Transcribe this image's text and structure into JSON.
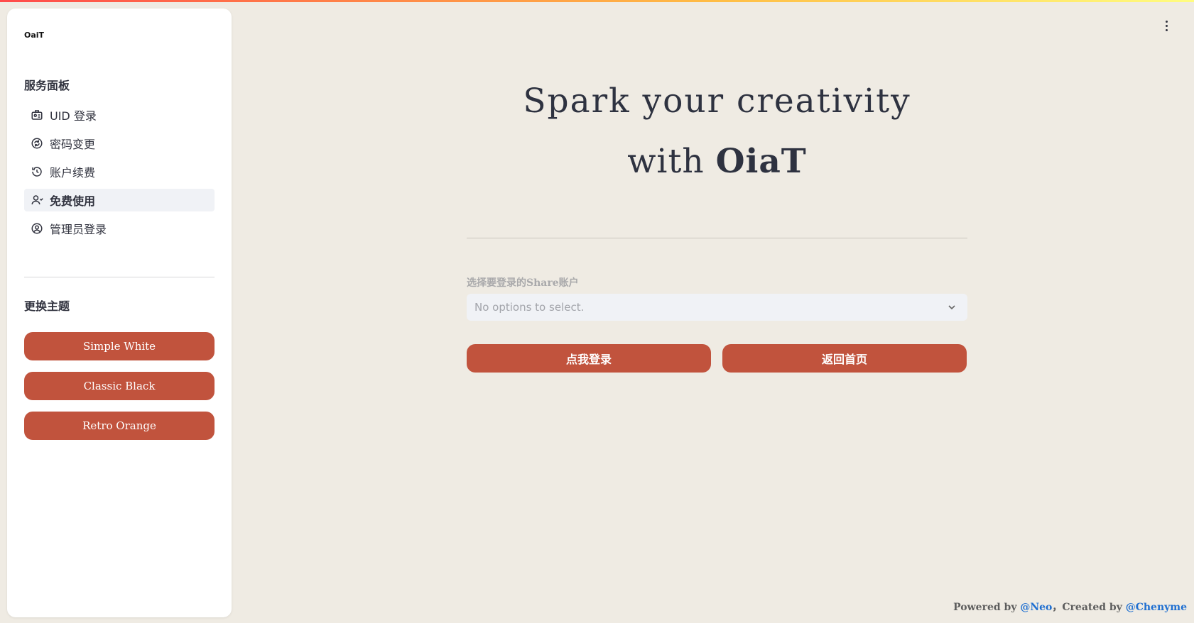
{
  "app": {
    "logo_text": "OaiT",
    "accent_color": "#c1533d"
  },
  "sidebar": {
    "panel_title": "服务面板",
    "items": [
      {
        "label": "UID 登录",
        "icon": "id-card-icon",
        "active": false
      },
      {
        "label": "密码变更",
        "icon": "refresh-circle-icon",
        "active": false
      },
      {
        "label": "账户续费",
        "icon": "history-icon",
        "active": false
      },
      {
        "label": "免费使用",
        "icon": "user-icon",
        "active": true
      },
      {
        "label": "管理员登录",
        "icon": "account-circle-icon",
        "active": false
      }
    ],
    "theme_title": "更换主题",
    "themes": [
      "Simple White",
      "Classic Black",
      "Retro Orange"
    ]
  },
  "main": {
    "hero_line1": "Spark your creativity",
    "hero_line2_prefix": "with ",
    "hero_line2_brand": "OiaT",
    "select_label": "选择要登录的Share账户",
    "select_placeholder": "No options to select.",
    "login_button": "点我登录",
    "home_button": "返回首页"
  },
  "footer": {
    "powered_prefix": "Powered by ",
    "powered_link": "@Neo",
    "created_prefix": "，Created by ",
    "created_link": "@Chenyme"
  }
}
